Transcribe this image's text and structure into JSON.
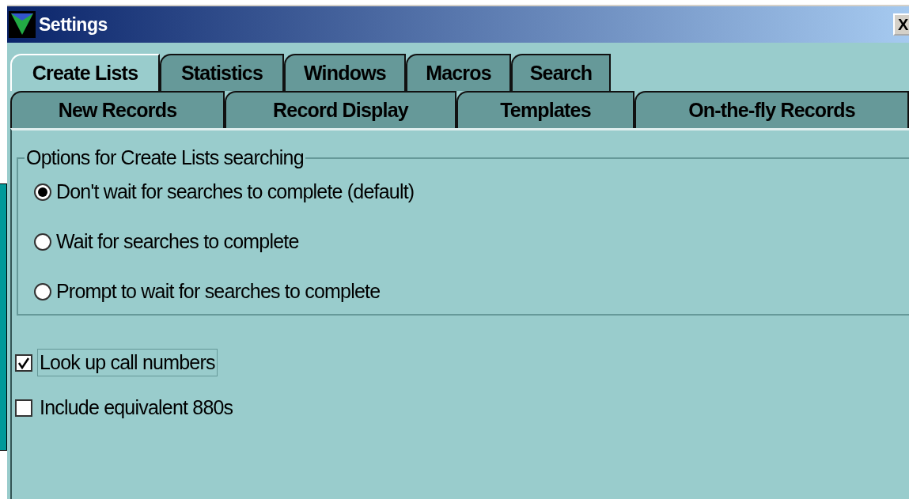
{
  "window": {
    "title": "Settings",
    "close": "X"
  },
  "tab_rows": [
    {
      "tabs": [
        {
          "label": "Create Lists",
          "selected": true
        },
        {
          "label": "Statistics",
          "selected": false
        },
        {
          "label": "Windows",
          "selected": false
        },
        {
          "label": "Macros",
          "selected": false
        },
        {
          "label": "Search",
          "selected": false
        }
      ]
    },
    {
      "tabs": [
        {
          "label": "New Records",
          "selected": false
        },
        {
          "label": "Record Display",
          "selected": false
        },
        {
          "label": "Templates",
          "selected": false
        },
        {
          "label": "On-the-fly Records",
          "selected": false
        }
      ]
    }
  ],
  "group": {
    "title": "Options for Create Lists searching",
    "options": [
      {
        "label": "Don't wait for searches to complete (default)",
        "selected": true
      },
      {
        "label": "Wait for searches to complete",
        "selected": false
      },
      {
        "label": "Prompt to wait for searches to complete",
        "selected": false
      }
    ]
  },
  "checkboxes": [
    {
      "label": "Look up call numbers",
      "checked": true,
      "focused": true
    },
    {
      "label": "Include equivalent 880s",
      "checked": false,
      "focused": false
    }
  ]
}
